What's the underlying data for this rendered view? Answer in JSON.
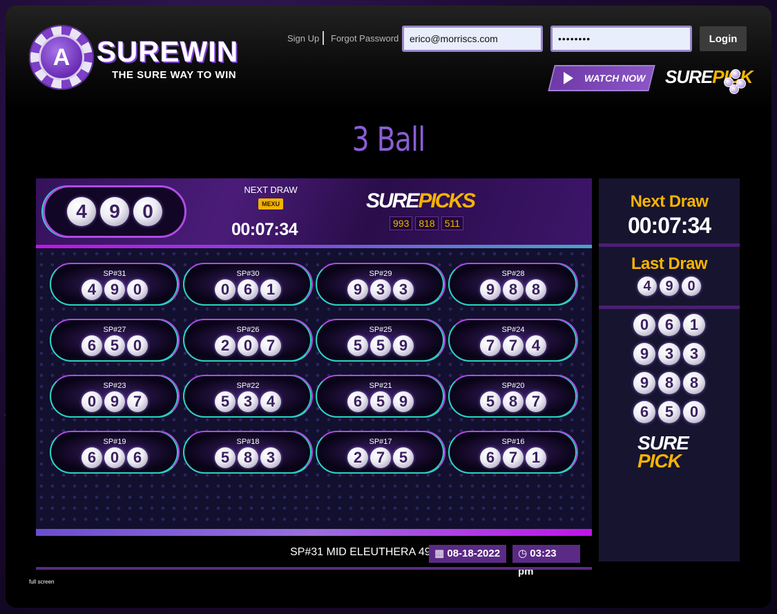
{
  "header": {
    "logo_word": "SUREWIN",
    "logo_tagline": "THE SURE WAY TO WIN",
    "logo_letter": "A",
    "sign_up": "Sign Up",
    "forgot_password": "Forgot Password",
    "email_value": "erico@morriscs.com",
    "password_value": "••••••••",
    "login_label": "Login",
    "watch_now": "WATCH NOW",
    "surepick_sure": "SURE",
    "surepick_pick": "PICK"
  },
  "title": "3 Ball",
  "current": {
    "balls": [
      "4",
      "9",
      "0"
    ],
    "next_draw_label": "NEXT DRAW",
    "badge": "MEXU",
    "timer": "00:07:34",
    "surepicks_sure": "SURE",
    "surepicks_picks": "PICKS",
    "picks": [
      "993",
      "818",
      "511"
    ]
  },
  "results": [
    {
      "label": "SP#31",
      "balls": [
        "4",
        "9",
        "0"
      ]
    },
    {
      "label": "SP#30",
      "balls": [
        "0",
        "6",
        "1"
      ]
    },
    {
      "label": "SP#29",
      "balls": [
        "9",
        "3",
        "3"
      ]
    },
    {
      "label": "SP#28",
      "balls": [
        "9",
        "8",
        "8"
      ]
    },
    {
      "label": "SP#27",
      "balls": [
        "6",
        "5",
        "0"
      ]
    },
    {
      "label": "SP#26",
      "balls": [
        "2",
        "0",
        "7"
      ]
    },
    {
      "label": "SP#25",
      "balls": [
        "5",
        "5",
        "9"
      ]
    },
    {
      "label": "SP#24",
      "balls": [
        "7",
        "7",
        "4"
      ]
    },
    {
      "label": "SP#23",
      "balls": [
        "0",
        "9",
        "7"
      ]
    },
    {
      "label": "SP#22",
      "balls": [
        "5",
        "3",
        "4"
      ]
    },
    {
      "label": "SP#21",
      "balls": [
        "6",
        "5",
        "9"
      ]
    },
    {
      "label": "SP#20",
      "balls": [
        "5",
        "8",
        "7"
      ]
    },
    {
      "label": "SP#19",
      "balls": [
        "6",
        "0",
        "6"
      ]
    },
    {
      "label": "SP#18",
      "balls": [
        "5",
        "8",
        "3"
      ]
    },
    {
      "label": "SP#17",
      "balls": [
        "2",
        "7",
        "5"
      ]
    },
    {
      "label": "SP#16",
      "balls": [
        "6",
        "7",
        "1"
      ]
    }
  ],
  "footer": {
    "draw_info": "SP#31 MID ELEUTHERA 49",
    "date": "08-18-2022",
    "time": "03:23 pm",
    "fullscreen": "full screen"
  },
  "sidebar": {
    "next_draw_title": "Next Draw",
    "next_draw_timer": "00:07:34",
    "last_draw_title": "Last Draw",
    "last_draw_balls": [
      "4",
      "9",
      "0"
    ],
    "history": [
      [
        "0",
        "6",
        "1"
      ],
      [
        "9",
        "3",
        "3"
      ],
      [
        "9",
        "8",
        "8"
      ],
      [
        "6",
        "5",
        "0"
      ]
    ],
    "surepick_sure": "SURE",
    "surepick_pick": "PICK"
  },
  "colors": {
    "accent_purple": "#8a5ed6",
    "gold": "#f5b400",
    "border_purple": "#b04be6",
    "border_teal": "#29d4c0"
  },
  "icons": [
    "calendar-icon",
    "clock-icon",
    "play-icon"
  ]
}
